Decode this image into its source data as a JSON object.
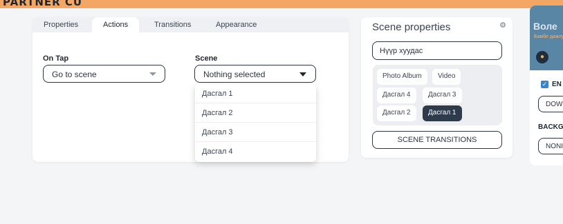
{
  "header": {
    "banner_text": "PARTNER CU"
  },
  "tabs": [
    {
      "label": "Properties",
      "active": false
    },
    {
      "label": "Actions",
      "active": true
    },
    {
      "label": "Transitions",
      "active": false
    },
    {
      "label": "Appearance",
      "active": false
    }
  ],
  "actions": {
    "on_tap_label": "On Tap",
    "on_tap_value": "Go to scene",
    "scene_label": "Scene",
    "scene_value": "Nothing selected",
    "scene_options": [
      "Дасгал 1",
      "Дасгал 2",
      "Дасгал 3",
      "Дасгал 4"
    ]
  },
  "scene_properties": {
    "title": "Scene properties",
    "settings_icon": "gear-icon",
    "name_value": "Нүүр хуудас",
    "scenes": [
      {
        "label": "Photo Album",
        "selected": false
      },
      {
        "label": "Video",
        "selected": false
      },
      {
        "label": "Дасгал 4",
        "selected": false
      },
      {
        "label": "Дасгал 3",
        "selected": false
      },
      {
        "label": "Дасгал 2",
        "selected": false
      },
      {
        "label": "Дасгал 1",
        "selected": true
      }
    ],
    "transitions_button": "SCENE TRANSITIONS"
  },
  "right_panel": {
    "thumb_title": "Воле",
    "thumb_subtitle": "Бамбе дажлуу",
    "enable_label": "EN",
    "enable_checked": true,
    "download_button": "DOW",
    "background_label": "BACKG",
    "background_value": "NONI"
  },
  "colors": {
    "accent": "#2d3b4d",
    "banner": "#f4a765",
    "checkbox": "#3a86c8"
  }
}
